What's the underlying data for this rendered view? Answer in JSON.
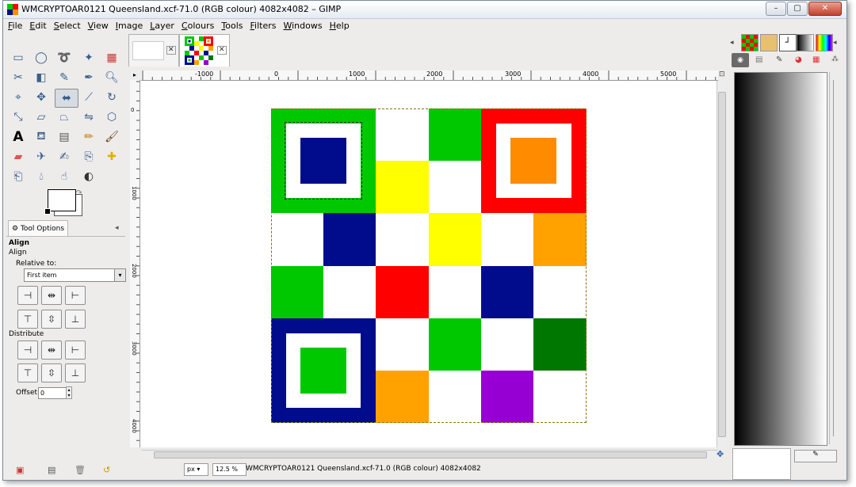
{
  "window": {
    "title": "WMCRYPTOAR0121 Queensland.xcf-71.0 (RGB colour) 4082x4082 – GIMP",
    "minimize": "–",
    "maximize": "▢",
    "close": "✕"
  },
  "menu": [
    "File",
    "Edit",
    "Select",
    "View",
    "Image",
    "Layer",
    "Colours",
    "Tools",
    "Filters",
    "Windows",
    "Help"
  ],
  "tool_options": {
    "tab_label": "Tool Options",
    "tool_title": "Align",
    "tool_subtitle": "Align",
    "relative_to_label": "Relative to:",
    "relative_to_value": "First item",
    "distribute_label": "Distribute",
    "offset_label": "Offset:",
    "offset_value": "0"
  },
  "rulers": {
    "h_ticks": [
      "-1000",
      "0",
      "1000",
      "2000",
      "3000",
      "4000",
      "5000"
    ],
    "v_ticks": [
      "0",
      "1000",
      "2000",
      "3000",
      "4000"
    ]
  },
  "status": {
    "unit": "px",
    "zoom": "12.5 %",
    "text": "WMCRYPTOAR0121 Queensland.xcf-71.0 (RGB colour) 4082x4082"
  },
  "colors": {
    "green": "#00c800",
    "navy": "#000c8c",
    "red": "#ff0000",
    "orange": "#ff8c00",
    "orange2": "#ffa200",
    "yellow": "#ffff00",
    "darkgreen": "#007800",
    "purple": "#9600d2",
    "white": "#ffffff"
  },
  "icons": {
    "app": "gimp-icon",
    "tools": [
      "rect-select-icon",
      "ellipse-select-icon",
      "lasso-icon",
      "fuzzy-select-icon",
      "color-select-icon",
      "scissors-icon",
      "foreground-select-icon",
      "paths-icon",
      "color-picker-icon",
      "zoom-icon",
      "measure-icon",
      "move-icon",
      "align-icon",
      "crop-icon",
      "rotate-icon",
      "scale-icon",
      "shear-icon",
      "perspective-icon",
      "flip-icon",
      "cage-icon",
      "text-icon",
      "bucket-fill-icon",
      "blend-icon",
      "pencil-icon",
      "paintbrush-icon",
      "eraser-icon",
      "airbrush-icon",
      "ink-icon",
      "clone-icon",
      "heal-icon",
      "perspective-clone-icon",
      "blur-icon",
      "smudge-icon",
      "dodge-burn-icon"
    ]
  }
}
